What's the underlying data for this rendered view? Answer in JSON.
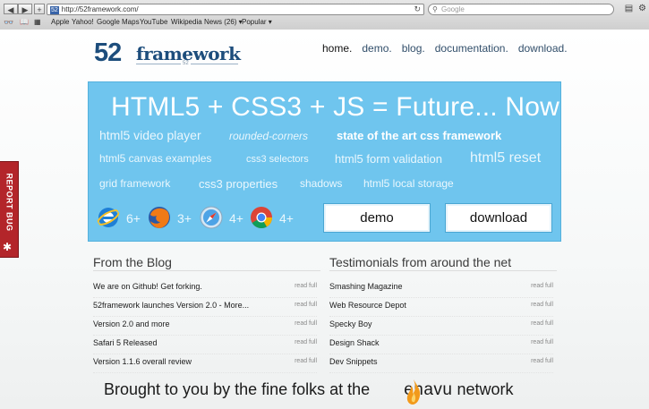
{
  "browser": {
    "url": "http://52framework.com/",
    "search_placeholder": "Google",
    "bookmarks": [
      "Apple",
      "Yahoo!",
      "Google Maps",
      "YouTube",
      "Wikipedia",
      "News (26) ▾",
      "Popular ▾"
    ]
  },
  "logo": {
    "number": "52",
    "word": "framework",
    "small": "52"
  },
  "nav": [
    "home.",
    "demo.",
    "blog.",
    "documentation.",
    "download."
  ],
  "hero": {
    "title": "HTML5  +  CSS3  + JS = Future... Now",
    "tags": [
      "html5 video player",
      "rounded-corners",
      "state of the art css framework",
      "html5 canvas examples",
      "css3 selectors",
      "html5 form validation",
      "html5 reset",
      "grid framework",
      "css3 properties",
      "shadows",
      "html5 local storage"
    ],
    "browsers": [
      {
        "icon": "ie-icon",
        "version": "6+"
      },
      {
        "icon": "firefox-icon",
        "version": "3+"
      },
      {
        "icon": "safari-icon",
        "version": "4+"
      },
      {
        "icon": "chrome-icon",
        "version": "4+"
      }
    ],
    "demo_label": "demo",
    "download_label": "download"
  },
  "blog": {
    "heading": "From the Blog",
    "items": [
      "We are on Github! Get forking.",
      "52framework launches Version 2.0 - More...",
      "Version 2.0 and more",
      "Safari 5 Released",
      "Version 1.1.6 overall review"
    ],
    "read_full": "read full"
  },
  "testimonials": {
    "heading": "Testimonials from around the net",
    "items": [
      "Smashing Magazine",
      "Web Resource Depot",
      "Specky Boy",
      "Design Shack",
      "Dev Snippets"
    ],
    "read_full": "read full"
  },
  "footer": {
    "text": "Brought to you by the fine folks at the",
    "brand": "enavu",
    "suffix": "network"
  },
  "report_bug": "REPORT BUG",
  "colors": {
    "hero": "#6fc5ee",
    "brand": "#1d4d7c",
    "bugtab": "#b3252a",
    "flame": "#f29a1b"
  }
}
